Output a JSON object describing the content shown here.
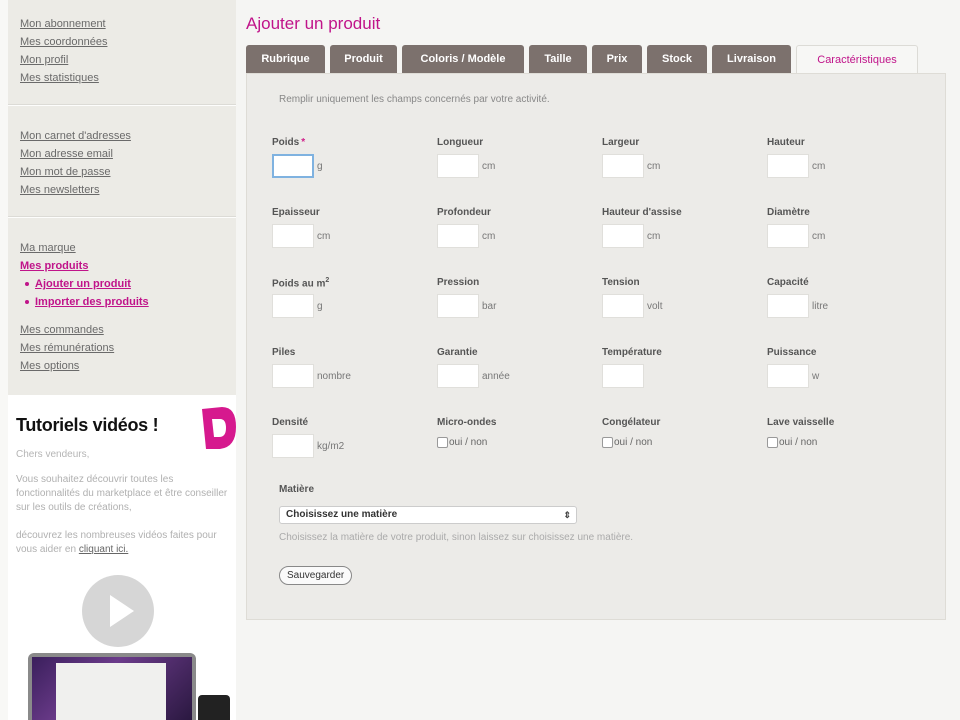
{
  "sidebar": {
    "group1": [
      "Mon abonnement",
      "Mes coordonnées",
      "Mon profil",
      "Mes statistiques"
    ],
    "group2": [
      "Mon carnet d'adresses",
      "Mon adresse email",
      "Mon mot de passe",
      "Mes newsletters"
    ],
    "marque": "Ma marque",
    "produits": "Mes produits",
    "sub_items": [
      "Ajouter un produit",
      "Importer des produits"
    ],
    "group4": [
      "Mes commandes",
      "Mes rémunérations",
      "Mes options"
    ]
  },
  "tutorial": {
    "title": "Tutoriels vidéos !",
    "greeting": "Chers vendeurs,",
    "paragraph1": "Vous souhaitez découvrir toutes les fonctionnalités du marketplace et être conseiller sur les outils de créations,",
    "paragraph2": "découvrez les nombreuses vidéos faites pour vous aider en",
    "link": "cliquant ici."
  },
  "page": {
    "title": "Ajouter un produit",
    "intro": "Remplir uniquement les champs concernés par votre activité.",
    "accent_color": "#c0148a"
  },
  "tabs": [
    "Rubrique",
    "Produit",
    "Coloris / Modèle",
    "Taille",
    "Prix",
    "Stock",
    "Livraison",
    "Caractéristiques"
  ],
  "active_tab": "Caractéristiques",
  "fields": {
    "poids": {
      "label": "Poids",
      "required": "*",
      "unit": "g"
    },
    "longueur": {
      "label": "Longueur",
      "unit": "cm"
    },
    "largeur": {
      "label": "Largeur",
      "unit": "cm"
    },
    "hauteur": {
      "label": "Hauteur",
      "unit": "cm"
    },
    "epaisseur": {
      "label": "Epaisseur",
      "unit": "cm"
    },
    "profondeur": {
      "label": "Profondeur",
      "unit": "cm"
    },
    "hauteur_assise": {
      "label": "Hauteur d'assise",
      "unit": "cm"
    },
    "diametre": {
      "label": "Diamètre",
      "unit": "cm"
    },
    "poids_m2": {
      "label": "Poids au m",
      "sup": "2",
      "unit": "g"
    },
    "pression": {
      "label": "Pression",
      "unit": "bar"
    },
    "tension": {
      "label": "Tension",
      "unit": "volt"
    },
    "capacite": {
      "label": "Capacité",
      "unit": "litre"
    },
    "piles": {
      "label": "Piles",
      "unit": "nombre"
    },
    "garantie": {
      "label": "Garantie",
      "unit": "année"
    },
    "temperature": {
      "label": "Température",
      "unit": ""
    },
    "puissance": {
      "label": "Puissance",
      "unit": "w"
    },
    "densite": {
      "label": "Densité",
      "unit": "kg/m2"
    },
    "micro_ondes": {
      "label": "Micro-ondes",
      "option": "oui / non"
    },
    "congelateur": {
      "label": "Congélateur",
      "option": "oui / non"
    },
    "lave_vaisselle": {
      "label": "Lave vaisselle",
      "option": "oui / non"
    }
  },
  "matiere": {
    "label": "Matière",
    "selected": "Choisissez une matière",
    "hint": "Choisissez la matière de votre produit, sinon laissez sur choisissez une matière."
  },
  "save_label": "Sauvegarder"
}
